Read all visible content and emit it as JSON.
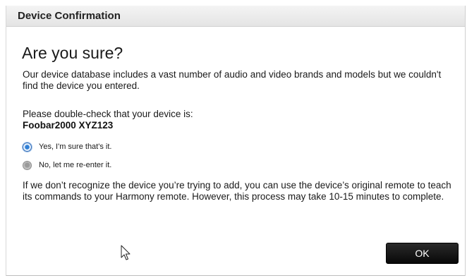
{
  "dialog": {
    "title": "Device Confirmation",
    "heading": "Are you sure?",
    "intro": "Our device database includes a vast number of audio and video brands and models but we couldn't find the device you entered.",
    "check_label": "Please double-check that your device is:",
    "device_name": "Foobar2000 XYZ123",
    "options": [
      {
        "label": "Yes, I'm sure that's it.",
        "checked": true
      },
      {
        "label": "No, let me re-enter it.",
        "checked": false
      }
    ],
    "footer_text": "If we don’t recognize the device you’re trying to add, you can use the device’s original remote to teach its commands to your Harmony remote. However, this process may take 10-15 minutes to complete.",
    "ok_label": "OK"
  },
  "colors": {
    "ok_button_bg": "#0a0a0a",
    "radio_selected": "#2f7fd6",
    "titlebar_bg": "#e9e9e9"
  },
  "icons": {
    "cursor": "mouse-pointer-icon"
  }
}
